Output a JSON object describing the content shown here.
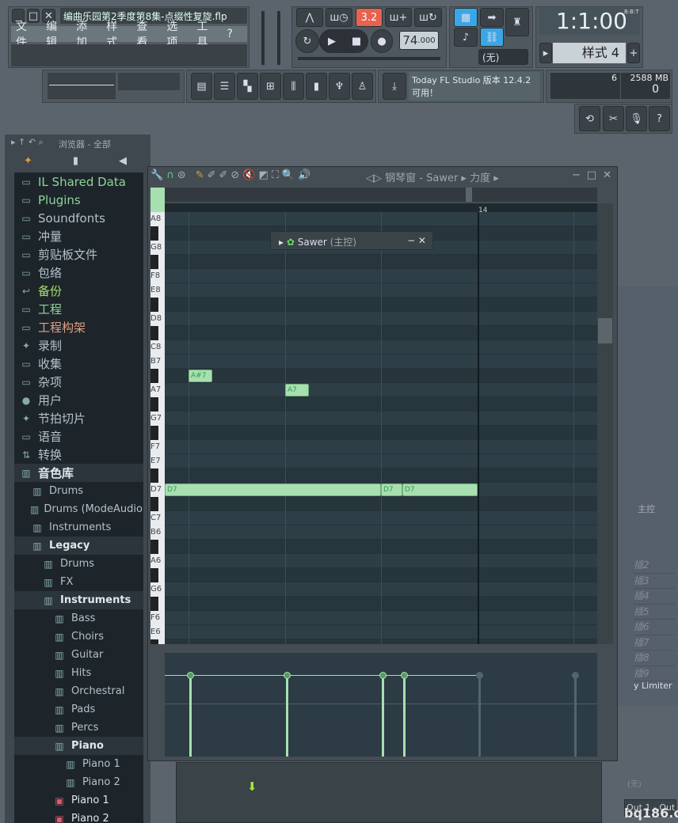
{
  "window": {
    "title": "编曲乐园第2季度第8集-点缀性复旋.flp",
    "menu": [
      "文件",
      "编辑",
      "添加",
      "样式",
      "查看",
      "选项",
      "工具",
      "?"
    ]
  },
  "transport": {
    "pat_song": "3.2",
    "tempo": "74",
    "tempo_frac": ".000",
    "time": "1:1:00",
    "time_format": "B:B:T",
    "pattern": "样式 4",
    "snap": "(无)"
  },
  "hint": {
    "line1": "Today  FL Studio 版本 12.4.2",
    "line2": "可用！"
  },
  "monitor": {
    "voices": "6",
    "memory": "2588 MB",
    "cpu": "0"
  },
  "browser": {
    "title": "浏览器 - 全部",
    "items": [
      {
        "label": "IL Shared Data",
        "icon": "folder-plus-icon",
        "color": "#8fd49a",
        "depth": 0
      },
      {
        "label": "Plugins",
        "icon": "folder-plus-icon",
        "color": "#8fd49a",
        "depth": 0
      },
      {
        "label": "Soundfonts",
        "icon": "folder-icon",
        "color": "#b4c0c8",
        "depth": 0
      },
      {
        "label": "冲量",
        "icon": "folder-icon",
        "color": "#b4c0c8",
        "depth": 0
      },
      {
        "label": "剪贴板文件",
        "icon": "folder-icon",
        "color": "#b4c0c8",
        "depth": 0
      },
      {
        "label": "包络",
        "icon": "folder-icon",
        "color": "#b4c0c8",
        "depth": 0
      },
      {
        "label": "备份",
        "icon": "folder-backup-icon",
        "color": "#a8e070",
        "depth": 0
      },
      {
        "label": "工程",
        "icon": "folder-plus-icon",
        "color": "#8fd49a",
        "depth": 0
      },
      {
        "label": "工程构架",
        "icon": "folder-icon",
        "color": "#e0a080",
        "depth": 0
      },
      {
        "label": "录制",
        "icon": "waveform-icon",
        "color": "#b4c0c8",
        "depth": 0
      },
      {
        "label": "收集",
        "icon": "folder-icon",
        "color": "#b4c0c8",
        "depth": 0
      },
      {
        "label": "杂项",
        "icon": "folder-icon",
        "color": "#b4c0c8",
        "depth": 0
      },
      {
        "label": "用户",
        "icon": "user-icon",
        "color": "#b4c0c8",
        "depth": 0
      },
      {
        "label": "节拍切片",
        "icon": "waveform-icon",
        "color": "#b4c0c8",
        "depth": 0
      },
      {
        "label": "语音",
        "icon": "folder-icon",
        "color": "#b4c0c8",
        "depth": 0
      },
      {
        "label": "转换",
        "icon": "convert-icon",
        "color": "#b4c0c8",
        "depth": 0
      },
      {
        "label": "音色库",
        "icon": "library-icon",
        "color": "#e0e8ec",
        "depth": 0,
        "open": true
      },
      {
        "label": "Drums",
        "icon": "library-icon",
        "color": "#b4c0c8",
        "depth": 1
      },
      {
        "label": "Drums (ModeAudio)",
        "icon": "library-icon",
        "color": "#b4c0c8",
        "depth": 1
      },
      {
        "label": "Instruments",
        "icon": "library-icon",
        "color": "#b4c0c8",
        "depth": 1
      },
      {
        "label": "Legacy",
        "icon": "library-icon",
        "color": "#e0e8ec",
        "depth": 1,
        "open": true
      },
      {
        "label": "Drums",
        "icon": "library-icon",
        "color": "#b4c0c8",
        "depth": 2
      },
      {
        "label": "FX",
        "icon": "library-icon",
        "color": "#b4c0c8",
        "depth": 2
      },
      {
        "label": "Instruments",
        "icon": "library-icon",
        "color": "#e0e8ec",
        "depth": 2,
        "open": true
      },
      {
        "label": "Bass",
        "icon": "library-icon",
        "color": "#b4c0c8",
        "depth": 3
      },
      {
        "label": "Choirs",
        "icon": "library-icon",
        "color": "#b4c0c8",
        "depth": 3
      },
      {
        "label": "Guitar",
        "icon": "library-icon",
        "color": "#b4c0c8",
        "depth": 3
      },
      {
        "label": "Hits",
        "icon": "library-icon",
        "color": "#b4c0c8",
        "depth": 3
      },
      {
        "label": "Orchestral",
        "icon": "library-icon",
        "color": "#b4c0c8",
        "depth": 3
      },
      {
        "label": "Pads",
        "icon": "library-icon",
        "color": "#b4c0c8",
        "depth": 3
      },
      {
        "label": "Percs",
        "icon": "library-icon",
        "color": "#b4c0c8",
        "depth": 3
      },
      {
        "label": "Piano",
        "icon": "library-icon",
        "color": "#e0e8ec",
        "depth": 3,
        "open": true
      },
      {
        "label": "Piano 1",
        "icon": "library-icon",
        "color": "#b4c0c8",
        "depth": 4
      },
      {
        "label": "Piano 2",
        "icon": "library-icon",
        "color": "#b4c0c8",
        "depth": 4
      },
      {
        "label": "Piano 1",
        "icon": "preset-icon",
        "color": "#e0e8ec",
        "depth": 3
      },
      {
        "label": "Piano 2",
        "icon": "preset-icon",
        "color": "#e0e8ec",
        "depth": 3
      }
    ]
  },
  "piano_roll": {
    "title": "钢琴窗 - Sawer",
    "target": "力度",
    "bar_label": "14",
    "channel_popup": "Sawer",
    "channel_popup_suffix": "(主控)",
    "key_labels": [
      {
        "k": "A8",
        "i": 0
      },
      {
        "k": "G8",
        "i": 2
      },
      {
        "k": "F8",
        "i": 4
      },
      {
        "k": "E8",
        "i": 5
      },
      {
        "k": "D8",
        "i": 7
      },
      {
        "k": "C8",
        "i": 9
      },
      {
        "k": "B7",
        "i": 10
      },
      {
        "k": "A7",
        "i": 12
      },
      {
        "k": "G7",
        "i": 14
      },
      {
        "k": "F7",
        "i": 16
      },
      {
        "k": "E7",
        "i": 17
      },
      {
        "k": "D7",
        "i": 19
      },
      {
        "k": "C7",
        "i": 21
      },
      {
        "k": "B6",
        "i": 22
      },
      {
        "k": "A6",
        "i": 24
      },
      {
        "k": "G6",
        "i": 26
      },
      {
        "k": "F6",
        "i": 28
      },
      {
        "k": "E6",
        "i": 29
      }
    ],
    "notes": [
      {
        "label": "A#7",
        "row": 11,
        "start": 0.25,
        "len": 0.25
      },
      {
        "label": "A7",
        "row": 12,
        "start": 1.25,
        "len": 0.25
      },
      {
        "label": "D7",
        "row": 19,
        "start": 0,
        "len": 2.25
      },
      {
        "label": "D7",
        "row": 19,
        "start": 2.25,
        "len": 0.22
      },
      {
        "label": "D7",
        "row": 19,
        "start": 2.47,
        "len": 0.78
      }
    ],
    "velocities": [
      {
        "t": 0.25,
        "active": true
      },
      {
        "t": 1.25,
        "active": true
      },
      {
        "t": 2.25,
        "active": true
      },
      {
        "t": 2.47,
        "active": true
      },
      {
        "t": 3.25,
        "active": false
      },
      {
        "t": 4.25,
        "active": false
      }
    ]
  },
  "mixer_side": {
    "header": "主控",
    "rows": [
      "2",
      "3",
      "4",
      "5",
      "6",
      "7",
      "8",
      "9"
    ],
    "row_prefix": "插",
    "limiter": "y Limiter",
    "none": "(无)",
    "out": "Out 1 - Out"
  },
  "watermark": "bq186.com"
}
